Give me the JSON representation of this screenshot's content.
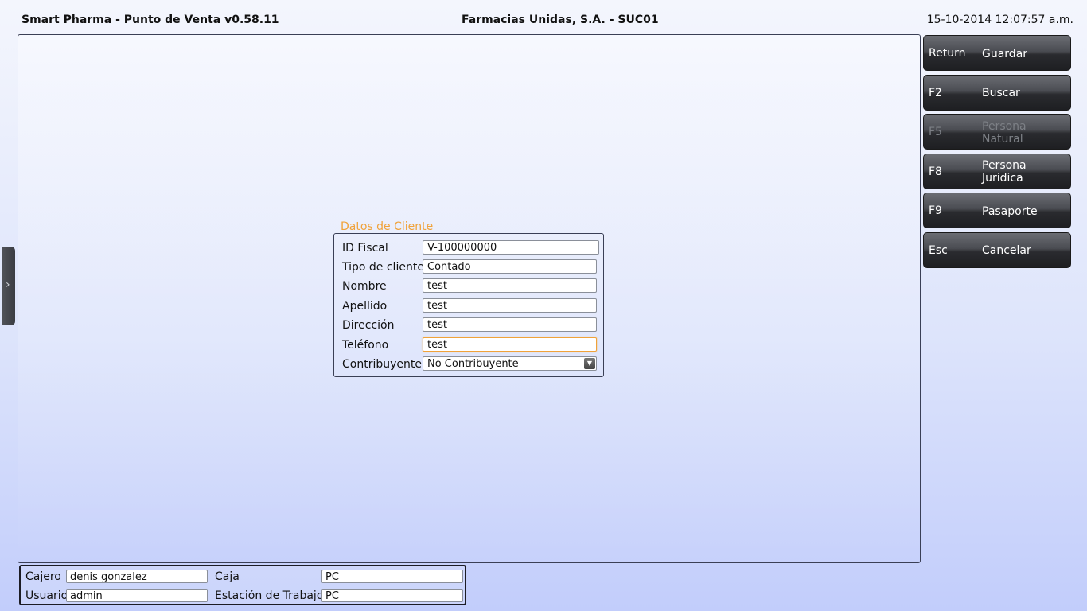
{
  "header": {
    "app_title": "Smart Pharma - Punto de Venta  v0.58.11",
    "company": "Farmacias Unidas, S.A.  -  SUC01",
    "datetime": "15-10-2014 12:07:57 a.m."
  },
  "side_tab": {
    "glyph": "›"
  },
  "function_keys": [
    {
      "key": "Return",
      "label": "Guardar"
    },
    {
      "key": "F2",
      "label": "Buscar"
    },
    {
      "key": "F5",
      "label": "Persona Natural"
    },
    {
      "key": "F8",
      "label": "Persona Juridica"
    },
    {
      "key": "F9",
      "label": "Pasaporte"
    },
    {
      "key": "Esc",
      "label": "Cancelar"
    }
  ],
  "client_form": {
    "legend": "Datos de Cliente",
    "fields": {
      "id_fiscal": {
        "label": "ID Fiscal",
        "value": "V-100000000"
      },
      "tipo_cliente": {
        "label": "Tipo de cliente",
        "value": "Contado"
      },
      "nombre": {
        "label": "Nombre",
        "value": "test"
      },
      "apellido": {
        "label": "Apellido",
        "value": "test"
      },
      "direccion": {
        "label": "Dirección",
        "value": "test"
      },
      "telefono": {
        "label": "Teléfono",
        "value": "test"
      },
      "contribuyente": {
        "label": "Contribuyente",
        "value": "No Contribuyente"
      }
    }
  },
  "footer": {
    "cajero_label": "Cajero",
    "cajero_value": "denis gonzalez",
    "usuario_label": "Usuario",
    "usuario_value": "admin",
    "caja_label": "Caja",
    "caja_value": "PC",
    "estacion_label": "Estación de Trabajo",
    "estacion_value": "PC"
  },
  "colors": {
    "legend": "#f0a23a",
    "focus_border": "#f0a23a",
    "button_dark": "#2a2b2f"
  }
}
